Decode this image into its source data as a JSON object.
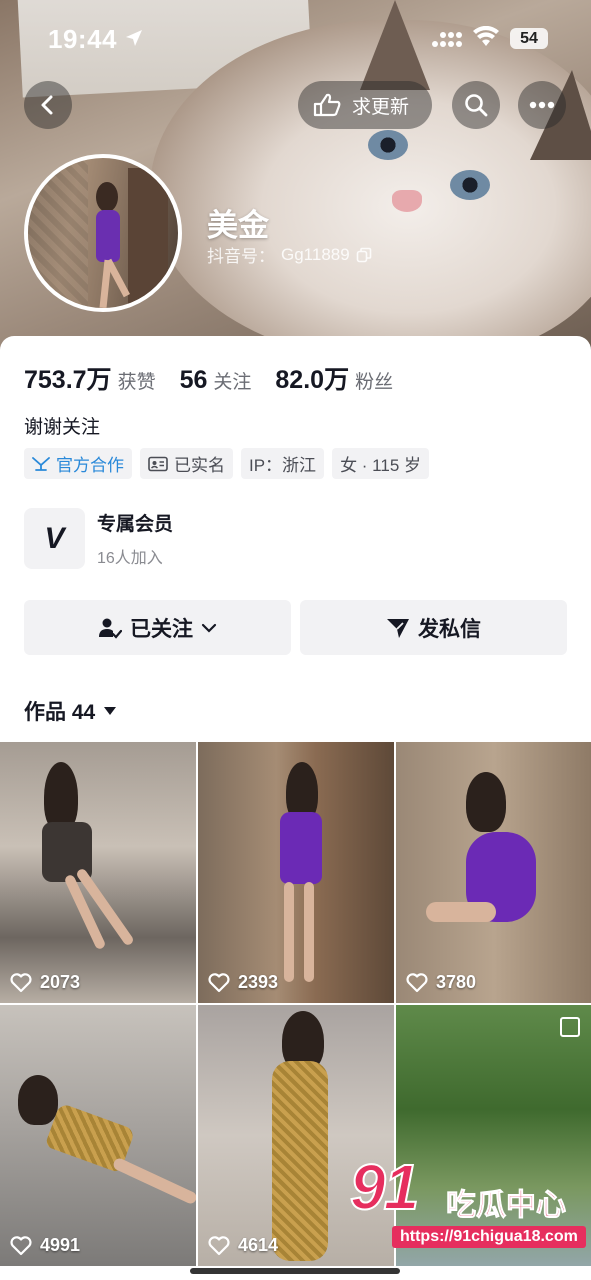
{
  "status_bar": {
    "time": "19:44",
    "battery": "54"
  },
  "header": {
    "update_label": "求更新",
    "name": "美金",
    "douyin_id_label": "抖音号：",
    "douyin_id": "Gg11889"
  },
  "stats": [
    {
      "value": "753.7万",
      "label": "获赞"
    },
    {
      "value": "56",
      "label": "关注"
    },
    {
      "value": "82.0万",
      "label": "粉丝"
    }
  ],
  "bio": "谢谢关注",
  "tags": [
    {
      "label": "官方合作",
      "icon": "official-icon"
    },
    {
      "label": "已实名",
      "icon": "id-card-icon"
    },
    {
      "label": "IP：浙江",
      "icon": ""
    },
    {
      "label": "女 · 115 岁",
      "icon": ""
    }
  ],
  "member": {
    "title": "专属会员",
    "subtitle": "16人加入",
    "logo": "V"
  },
  "actions": {
    "follow_label": "已关注",
    "message_label": "发私信"
  },
  "works": {
    "label": "作品 44"
  },
  "grid": [
    {
      "likes": "2073"
    },
    {
      "likes": "2393"
    },
    {
      "likes": "3780"
    },
    {
      "likes": "4991"
    },
    {
      "likes": "4614"
    },
    {
      "likes": ""
    }
  ],
  "watermark": {
    "number": "91",
    "text": "吃瓜中心",
    "url": "https://91chigua18.com"
  },
  "colors": {
    "accent_blue": "#2a89d9",
    "text_primary": "#161823",
    "text_secondary": "#6b6d74",
    "watermark_red": "#e62e5e"
  }
}
